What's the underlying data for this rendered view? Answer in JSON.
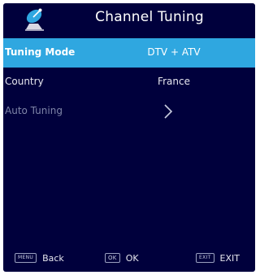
{
  "header": {
    "title": "Channel Tuning",
    "icon": "satellite-dish-icon"
  },
  "menu": [
    {
      "label": "Tuning Mode",
      "value": "DTV + ATV"
    },
    {
      "label": "Country",
      "value": "France"
    },
    {
      "label": "Auto Tuning",
      "value_icon": "chevron-right-icon"
    }
  ],
  "footer": {
    "back_key": "MENU",
    "back_label": "Back",
    "ok_key": "OK",
    "ok_label": "OK",
    "exit_key": "EXIT",
    "exit_label": "EXIT"
  },
  "colors": {
    "background": "#00003c",
    "highlight": "#2fa7e0",
    "disabled_text": "#7f85a8"
  }
}
